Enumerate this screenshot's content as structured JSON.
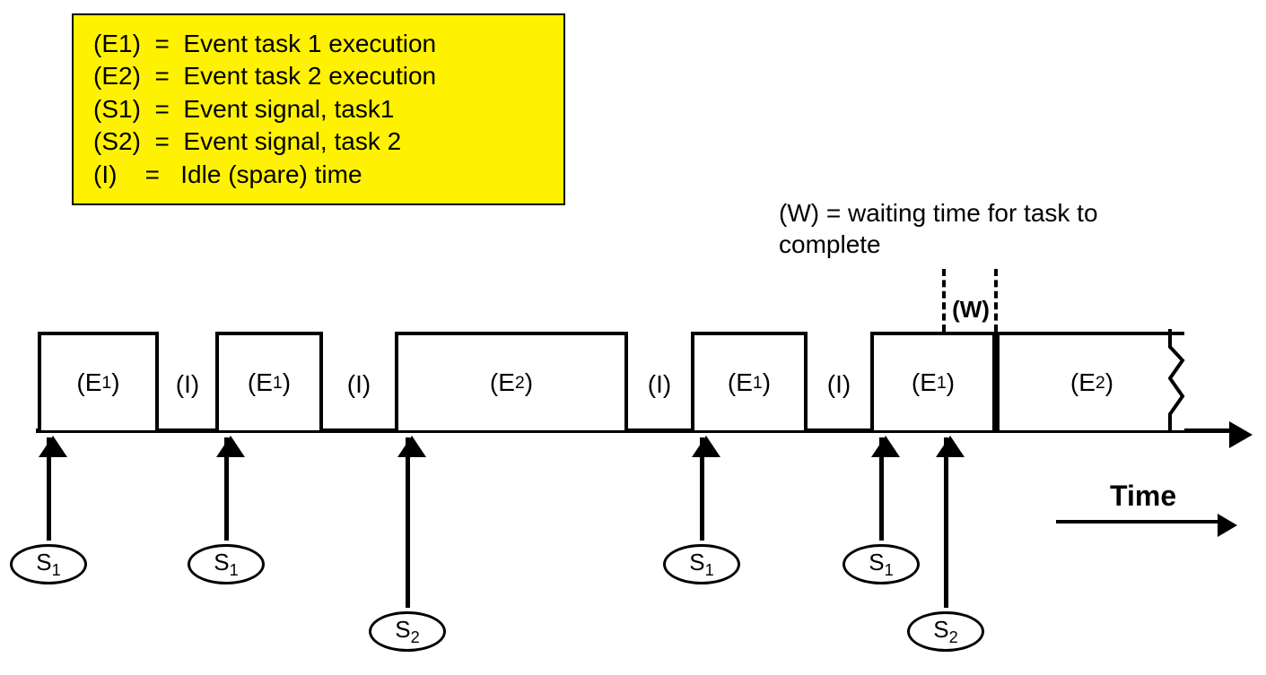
{
  "legend": {
    "rows": [
      {
        "key": "(E1)",
        "eq": "=",
        "desc": "Event task 1 execution"
      },
      {
        "key": "(E2)",
        "eq": "=",
        "desc": "Event task 2 execution"
      },
      {
        "key": "(S1)",
        "eq": "=",
        "desc": "Event signal, task1"
      },
      {
        "key": "(S2)",
        "eq": "=",
        "desc": "Event signal, task 2"
      },
      {
        "key": "(I)",
        "eq": "=",
        "desc": " Idle (spare) time"
      }
    ]
  },
  "wait_caption": {
    "line1": "(W) = waiting time for task to",
    "line2": "complete"
  },
  "w_marker_label": "(W)",
  "time_label": "Time",
  "blocks": [
    {
      "label_base": "E",
      "label_sub": "1"
    },
    {
      "label_base": "E",
      "label_sub": "1"
    },
    {
      "label_base": "E",
      "label_sub": "2"
    },
    {
      "label_base": "E",
      "label_sub": "1"
    },
    {
      "label_base": "E",
      "label_sub": "1"
    },
    {
      "label_base": "E",
      "label_sub": "2"
    }
  ],
  "idle_label": "(I)",
  "signals": [
    {
      "base": "S",
      "sub": "1"
    },
    {
      "base": "S",
      "sub": "1"
    },
    {
      "base": "S",
      "sub": "2"
    },
    {
      "base": "S",
      "sub": "1"
    },
    {
      "base": "S",
      "sub": "1"
    },
    {
      "base": "S",
      "sub": "2"
    }
  ]
}
